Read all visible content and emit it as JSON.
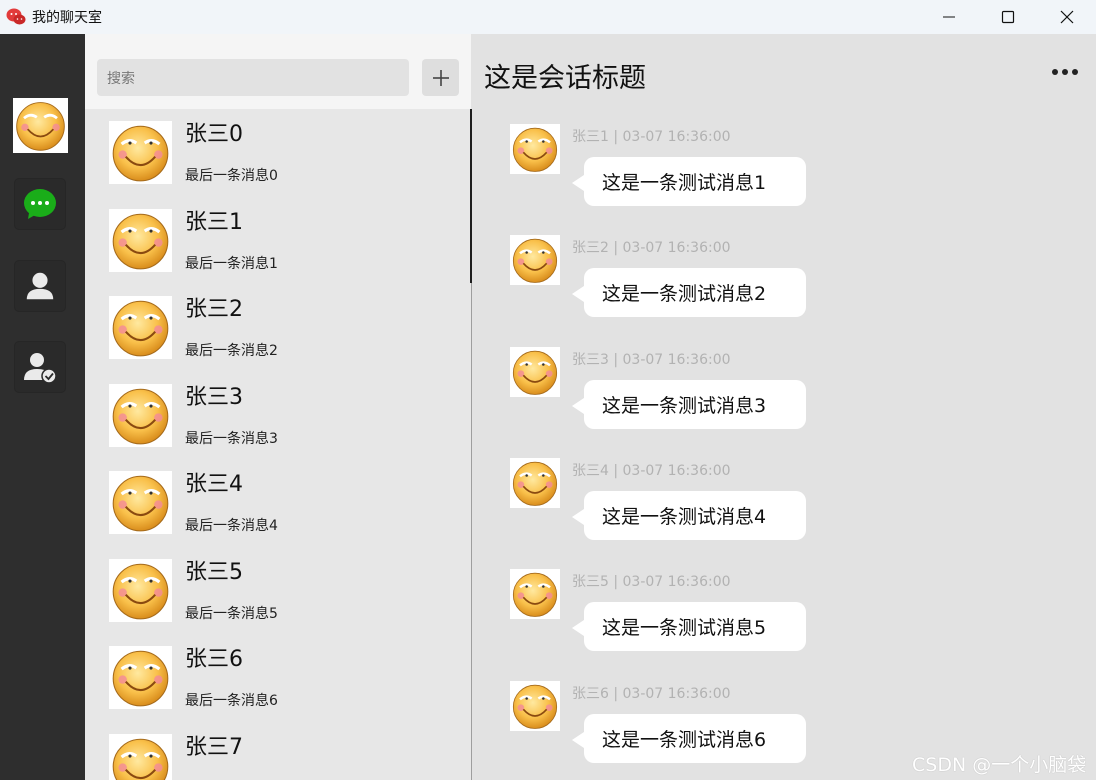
{
  "window": {
    "title": "我的聊天室",
    "minimize_icon": "minimize-icon",
    "maximize_icon": "maximize-icon",
    "close_icon": "close-icon"
  },
  "nav": {
    "items": [
      {
        "icon": "user-avatar"
      },
      {
        "icon": "chat-bubble-icon",
        "color": "#1aad19"
      },
      {
        "icon": "contacts-icon"
      },
      {
        "icon": "friend-verified-icon"
      }
    ]
  },
  "search": {
    "placeholder": "搜索",
    "add_icon": "plus-icon"
  },
  "contacts": [
    {
      "name": "张三0",
      "last": "最后一条消息0"
    },
    {
      "name": "张三1",
      "last": "最后一条消息1"
    },
    {
      "name": "张三2",
      "last": "最后一条消息2"
    },
    {
      "name": "张三3",
      "last": "最后一条消息3"
    },
    {
      "name": "张三4",
      "last": "最后一条消息4"
    },
    {
      "name": "张三5",
      "last": "最后一条消息5"
    },
    {
      "name": "张三6",
      "last": "最后一条消息6"
    },
    {
      "name": "张三7",
      "last": ""
    }
  ],
  "chat": {
    "title": "这是会话标题",
    "more_icon": "more-icon",
    "messages": [
      {
        "meta": "张三1 | 03-07 16:36:00",
        "text": "这是一条测试消息1"
      },
      {
        "meta": "张三2 | 03-07 16:36:00",
        "text": "这是一条测试消息2"
      },
      {
        "meta": "张三3 | 03-07 16:36:00",
        "text": "这是一条测试消息3"
      },
      {
        "meta": "张三4 | 03-07 16:36:00",
        "text": "这是一条测试消息4"
      },
      {
        "meta": "张三5 | 03-07 16:36:00",
        "text": "这是一条测试消息5"
      },
      {
        "meta": "张三6 | 03-07 16:36:00",
        "text": "这是一条测试消息6"
      }
    ]
  },
  "watermark": "CSDN @一个小脑袋",
  "colors": {
    "nav_bg": "#2e2e2e",
    "accent_green": "#1aad19",
    "bubble": "#ffffff",
    "meta_text": "#b2b2b2"
  }
}
